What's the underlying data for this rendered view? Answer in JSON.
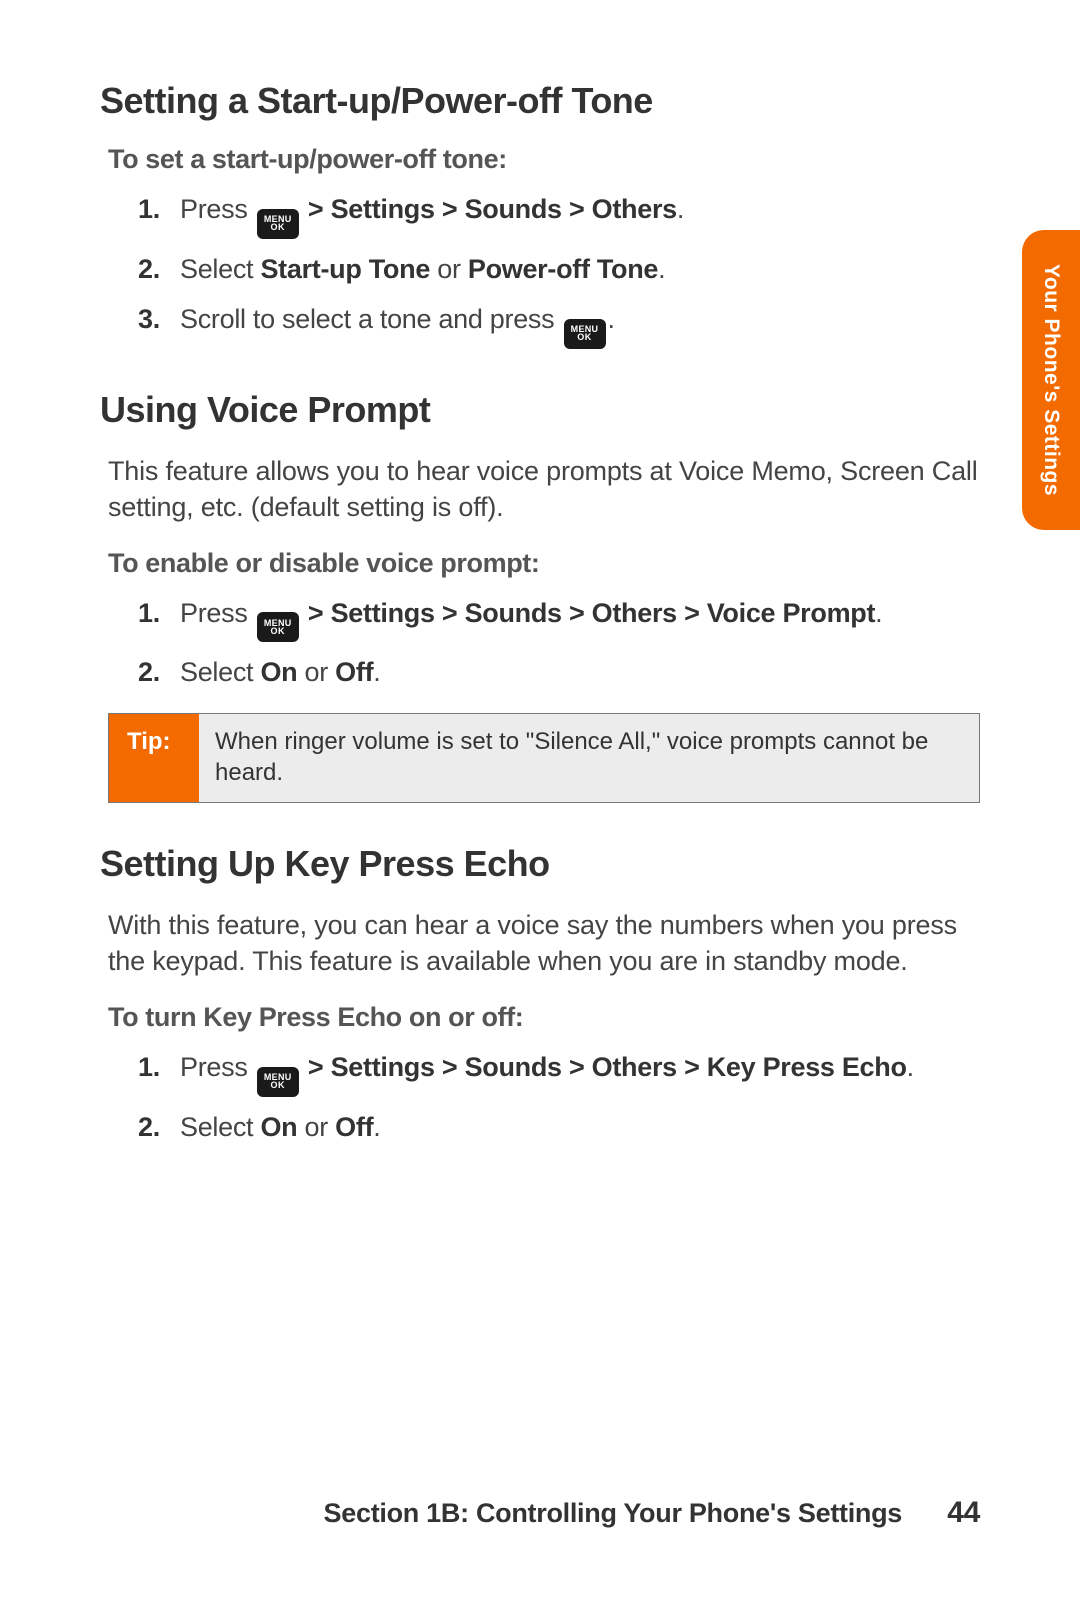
{
  "sideTab": "Your Phone's Settings",
  "menuKey": {
    "top": "MENU",
    "bottom": "OK"
  },
  "sections": {
    "s1": {
      "heading": "Setting a Start-up/Power-off Tone",
      "subhead": "To set a start-up/power-off tone:",
      "steps": {
        "n1": "1.",
        "a1pre": "Press ",
        "a1post": " > Settings > Sounds > Others",
        "n2": "2.",
        "a2pre": "Select ",
        "a2b1": "Start-up Tone",
        "a2mid": " or ",
        "a2b2": "Power-off Tone",
        "n3": "3.",
        "a3pre": "Scroll to select a tone and press "
      }
    },
    "s2": {
      "heading": "Using Voice Prompt",
      "intro": "This feature allows you to hear voice prompts at Voice Memo, Screen Call setting, etc. (default setting is off).",
      "subhead": "To enable or disable voice prompt:",
      "steps": {
        "n1": "1.",
        "a1pre": "Press ",
        "a1post": " > Settings > Sounds > Others > Voice Prompt",
        "n2": "2.",
        "a2pre": "Select ",
        "a2b1": "On",
        "a2mid": " or ",
        "a2b2": "Off"
      },
      "tipLabel": "Tip:",
      "tipBody": "When ringer volume is set to \"Silence All,\" voice prompts cannot be heard."
    },
    "s3": {
      "heading": "Setting Up Key Press Echo",
      "intro": "With this feature, you can hear a voice say the numbers when you press the keypad. This feature is available when you are in standby mode.",
      "subhead": "To turn Key Press Echo on or off:",
      "steps": {
        "n1": "1.",
        "a1pre": "Press ",
        "a1post": " > Settings > Sounds > Others > Key Press Echo",
        "n2": "2.",
        "a2pre": "Select ",
        "a2b1": "On",
        "a2mid": " or ",
        "a2b2": "Off"
      }
    }
  },
  "footer": {
    "section": "Section 1B: Controlling Your Phone's Settings",
    "page": "44"
  }
}
